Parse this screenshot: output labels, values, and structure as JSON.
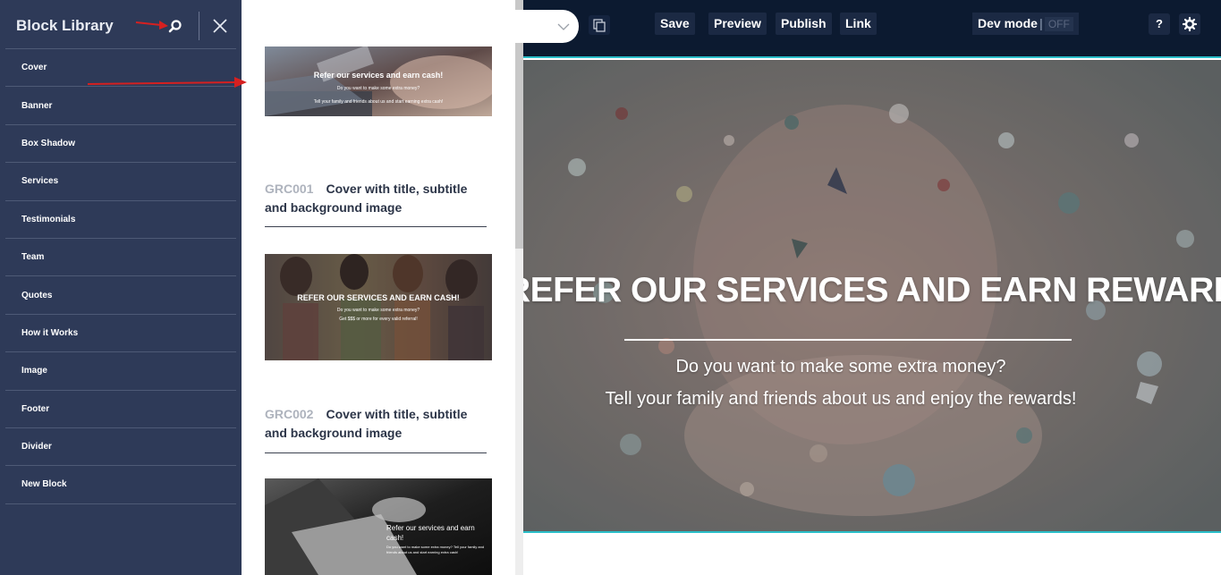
{
  "sidebar": {
    "title": "Block Library",
    "items": [
      "Cover",
      "Banner",
      "Box Shadow",
      "Services",
      "Testimonials",
      "Team",
      "Quotes",
      "How it Works",
      "Image",
      "Footer",
      "Divider",
      "New Block"
    ]
  },
  "blocks": [
    {
      "thumb_title": "Refer our services and earn cash!",
      "thumb_sub": "Do you want to make some extra money?",
      "thumb_sub2": "Tell your family and friends about us and start earning extra cash!"
    },
    {
      "code": "GRC001",
      "title": "Cover with title, subtitle and background image",
      "thumb_title": "REFER OUR SERVICES AND EARN CASH!",
      "thumb_sub": "Do you want to make some extra money?",
      "thumb_sub2": "Get $$$ or more for every valid referral!"
    },
    {
      "code": "GRC002",
      "title": "Cover with title, subtitle and background image",
      "thumb_title": "Refer our services and earn cash!",
      "thumb_sub": "Do you want to make some extra money? Tell your family and friends about us and start earning extra cash!"
    }
  ],
  "toolbar": {
    "save": "Save",
    "preview": "Preview",
    "publish": "Publish",
    "link": "Link",
    "dev_mode": "Dev mode",
    "dev_mode_separator": "|",
    "dev_mode_state": "OFF",
    "help": "?"
  },
  "hero": {
    "title": "REFER OUR SERVICES AND EARN REWARDS!",
    "subtitle_1": "Do you want to make some extra money?",
    "subtitle_2": "Tell your family and friends about us and enjoy the rewards!"
  },
  "colors": {
    "sidebar_bg": "#2e3a58",
    "topbar_bg": "#0c1a30",
    "accent_teal": "#2bbfc9",
    "annotation_red": "#d62020"
  },
  "icons": {
    "search": "search-icon",
    "close": "close-icon",
    "dropdown": "chevron-down-icon",
    "copy": "copy-icon",
    "settings": "gear-icon"
  }
}
